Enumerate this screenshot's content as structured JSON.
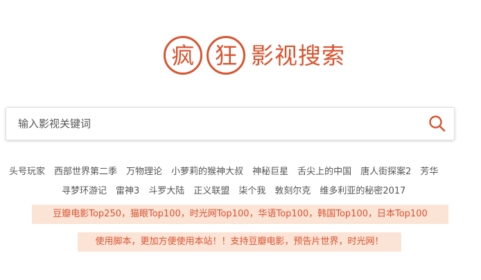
{
  "logo": {
    "circle_1": "疯",
    "circle_2": "狂",
    "text": "影视搜索"
  },
  "search": {
    "placeholder": "输入影视关键词",
    "icon": "search-icon"
  },
  "hot_keywords": {
    "row1": [
      "头号玩家",
      "西部世界第二季",
      "万物理论",
      "小萝莉的猴神大叔",
      "神秘巨星",
      "舌尖上的中国",
      "唐人街探案2",
      "芳华"
    ],
    "row2": [
      "寻梦环游记",
      "雷神3",
      "斗罗大陆",
      "正义联盟",
      "柒个我",
      "敦刻尔克",
      "维多利亚的秘密2017"
    ]
  },
  "notices": {
    "top_lists": "豆瓣电影Top250，猫眼Top100，时光网Top100，华语Top100，韩国Top100，日本Top100",
    "script_tip": "使用脚本，更加方便使用本站！！支持豆瓣电影，预告片世界，时光网！"
  },
  "colors": {
    "accent": "#d9532e",
    "notice_bg": "#fbe3d6"
  }
}
